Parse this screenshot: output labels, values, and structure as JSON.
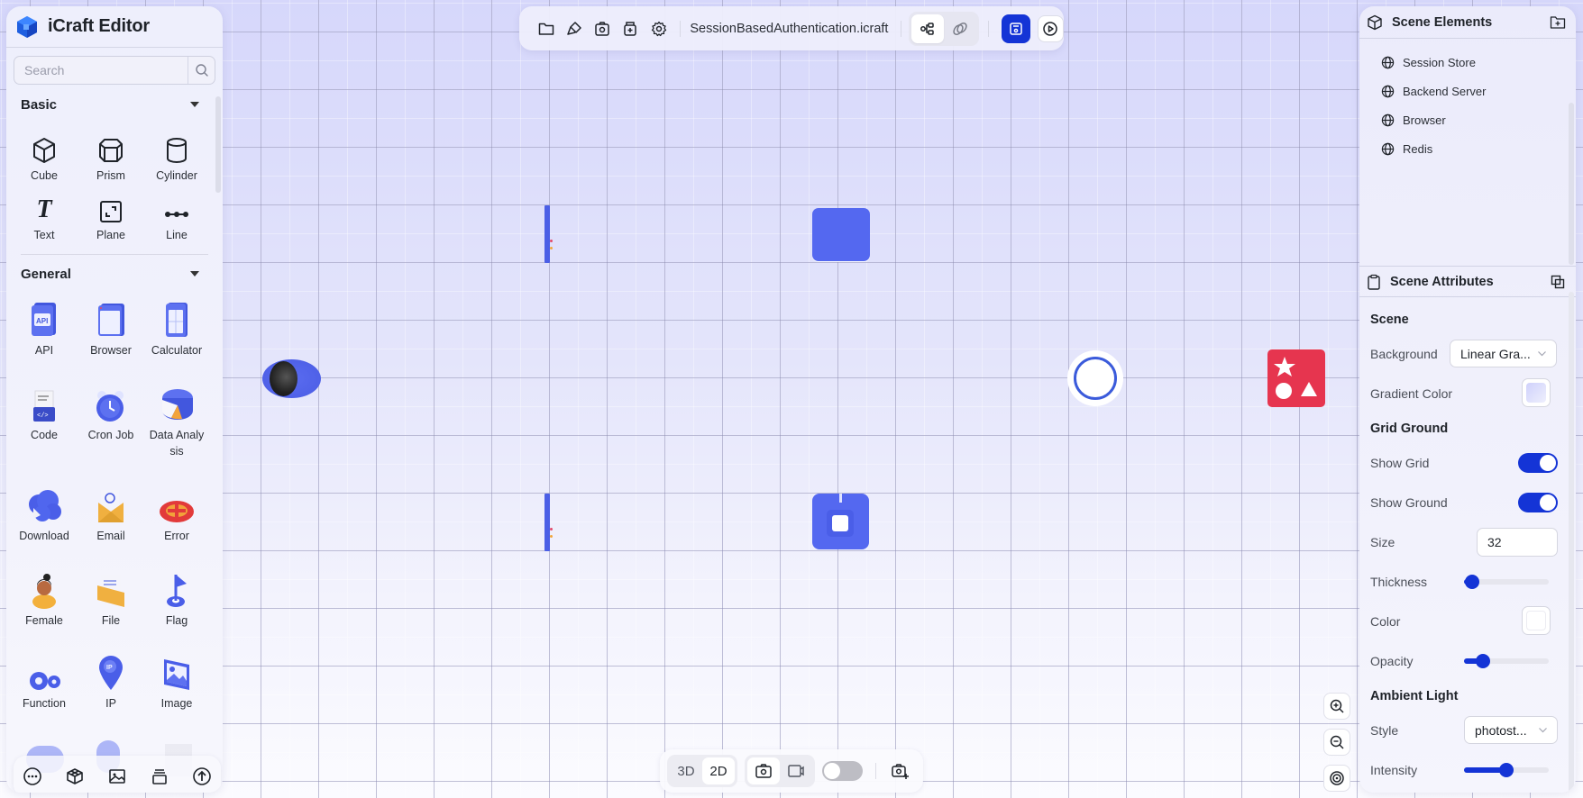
{
  "app": {
    "title": "iCraft Editor"
  },
  "search": {
    "placeholder": "Search",
    "value": ""
  },
  "library": {
    "sections": [
      {
        "name": "Basic",
        "expanded": true,
        "items": [
          {
            "label": "Cube",
            "icon": "cube-icon"
          },
          {
            "label": "Prism",
            "icon": "prism-icon"
          },
          {
            "label": "Cylinder",
            "icon": "cylinder-icon"
          },
          {
            "label": "Text",
            "icon": "text-icon"
          },
          {
            "label": "Plane",
            "icon": "plane-icon"
          },
          {
            "label": "Line",
            "icon": "line-icon"
          }
        ]
      },
      {
        "name": "General",
        "expanded": true,
        "items": [
          {
            "label": "API",
            "icon": "api-icon"
          },
          {
            "label": "Browser",
            "icon": "browser-icon"
          },
          {
            "label": "Calculator",
            "icon": "calculator-icon"
          },
          {
            "label": "Code",
            "icon": "code-icon"
          },
          {
            "label": "Cron Job",
            "icon": "cron-job-icon"
          },
          {
            "label": "Data Analy sis",
            "icon": "data-analysis-icon"
          },
          {
            "label": "Download",
            "icon": "download-icon"
          },
          {
            "label": "Email",
            "icon": "email-icon"
          },
          {
            "label": "Error",
            "icon": "error-icon"
          },
          {
            "label": "Female",
            "icon": "female-icon"
          },
          {
            "label": "File",
            "icon": "file-icon"
          },
          {
            "label": "Flag",
            "icon": "flag-icon"
          },
          {
            "label": "Function",
            "icon": "function-icon"
          },
          {
            "label": "IP",
            "icon": "ip-icon"
          },
          {
            "label": "Image",
            "icon": "image-icon"
          }
        ]
      }
    ]
  },
  "left_bottom_bar": {
    "buttons": [
      "more-icon",
      "model-box-icon",
      "image-icon",
      "layers-icon",
      "upload-icon"
    ]
  },
  "toolbar": {
    "file_name": "SessionBasedAuthentication.icraft",
    "left_icons": [
      "folder-icon",
      "brush-icon",
      "camera-icon",
      "archive-add-icon",
      "gear-icon"
    ],
    "mode_toggle": [
      "flow-icon",
      "link-icon"
    ],
    "active_mode": "flow-icon",
    "save_icon": "save-icon",
    "play_icon": "play-icon"
  },
  "view_bar": {
    "view_modes": [
      "3D",
      "2D"
    ],
    "active_view": "2D",
    "capture_modes": [
      "camera-icon",
      "video-icon"
    ],
    "active_capture": "camera-icon",
    "toggle_on": false,
    "screenshot_icon": "camera-plus-icon"
  },
  "zoom_controls": [
    "zoom-in-icon",
    "zoom-out-icon",
    "focus-target-icon"
  ],
  "scene_elements": {
    "title": "Scene Elements",
    "items": [
      "Session Store",
      "Backend Server",
      "Browser",
      "Redis"
    ]
  },
  "scene_attributes": {
    "title": "Scene Attributes",
    "scene": {
      "heading": "Scene",
      "background_label": "Background",
      "background_value": "Linear Gra...",
      "gradient_color_label": "Gradient Color",
      "gradient_color": "#d8d9fb"
    },
    "grid_ground": {
      "heading": "Grid Ground",
      "show_grid_label": "Show Grid",
      "show_grid": true,
      "show_ground_label": "Show Ground",
      "show_ground": true,
      "size_label": "Size",
      "size_value": "32",
      "thickness_label": "Thickness",
      "thickness": 0.1,
      "color_label": "Color",
      "color": "#ffffff",
      "opacity_label": "Opacity",
      "opacity": 0.22
    },
    "ambient_light": {
      "heading": "Ambient Light",
      "style_label": "Style",
      "style_value": "photost...",
      "intensity_label": "Intensity",
      "intensity": 0.5
    }
  },
  "colors": {
    "accent": "#1434d6",
    "object_blue": "#5468f0",
    "error_red": "#e6354f"
  }
}
